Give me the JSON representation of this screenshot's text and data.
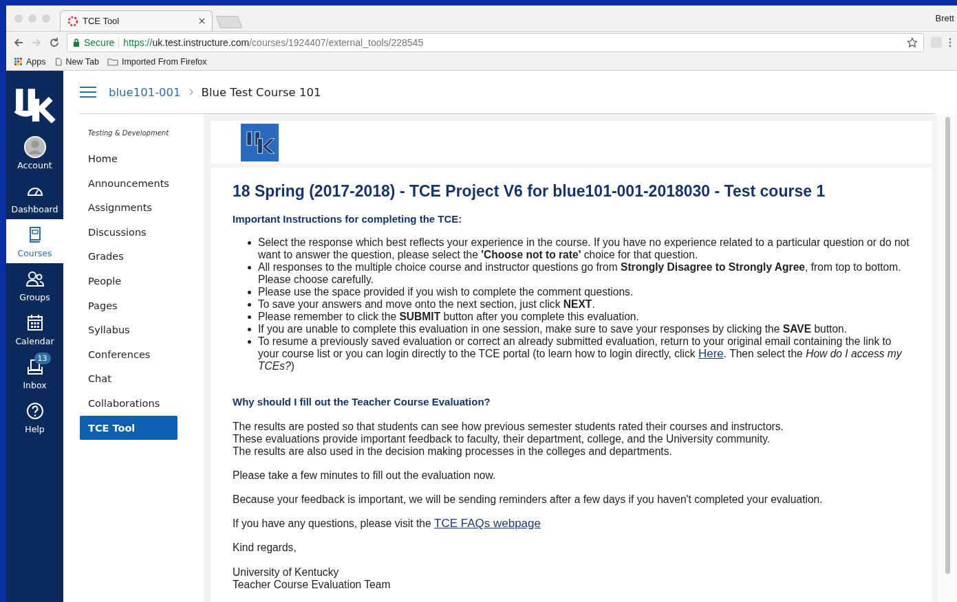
{
  "browser": {
    "tab_title": "TCE Tool",
    "profile": "Brett",
    "secure_label": "Secure",
    "url_scheme": "https://",
    "url_host": "uk.test.instructure.com",
    "url_path": "/courses/1924407/external_tools/228545",
    "bookmarks": [
      {
        "kind": "apps",
        "label": "Apps"
      },
      {
        "kind": "page",
        "label": "New Tab"
      },
      {
        "kind": "folder",
        "label": "Imported From Firefox"
      }
    ]
  },
  "global_nav": [
    {
      "kind": "account",
      "label": "Account",
      "selected": false
    },
    {
      "kind": "dashboard",
      "label": "Dashboard",
      "selected": false
    },
    {
      "kind": "courses",
      "label": "Courses",
      "selected": true
    },
    {
      "kind": "groups",
      "label": "Groups",
      "selected": false
    },
    {
      "kind": "calendar",
      "label": "Calendar",
      "selected": false
    },
    {
      "kind": "inbox",
      "label": "Inbox",
      "selected": false,
      "badge": "13"
    },
    {
      "kind": "help",
      "label": "Help",
      "selected": false
    }
  ],
  "breadcrumb": {
    "course_code": "blue101-001",
    "course_name": "Blue Test Course 101"
  },
  "course_nav": {
    "term": "Testing & Development",
    "items": [
      {
        "label": "Home",
        "selected": false
      },
      {
        "label": "Announcements",
        "selected": false
      },
      {
        "label": "Assignments",
        "selected": false
      },
      {
        "label": "Discussions",
        "selected": false
      },
      {
        "label": "Grades",
        "selected": false
      },
      {
        "label": "People",
        "selected": false
      },
      {
        "label": "Pages",
        "selected": false
      },
      {
        "label": "Syllabus",
        "selected": false
      },
      {
        "label": "Conferences",
        "selected": false
      },
      {
        "label": "Chat",
        "selected": false
      },
      {
        "label": "Collaborations",
        "selected": false
      },
      {
        "label": "TCE Tool",
        "selected": true
      }
    ]
  },
  "content": {
    "title": "18 Spring (2017-2018) - TCE Project V6 for blue101-001-2018030 - Test course 1",
    "instructions_heading": "Important Instructions for completing the TCE:",
    "instructions": [
      {
        "text": "Select the response which best reflects your experience in the course. If you have no experience related to a particular question or do not want to answer the question, please select the **'Choose not to rate'** choice for that question."
      },
      {
        "text": "All responses to the multiple choice course and instructor questions go from **Strongly Disagree to Strongly Agree**, from top to bottom. Please choose carefully."
      },
      {
        "text": "Please use the space provided if you wish to complete the comment questions."
      },
      {
        "text": "To save your answers and move onto the next section, just click **NEXT**."
      },
      {
        "text": "Please remember to click the **SUBMIT** button after you complete this evaluation."
      },
      {
        "text": "If you are unable to complete this evaluation in one session, make sure to save your responses by clicking the **SAVE** button."
      },
      {
        "text": "To resume a previously saved evaluation or correct an already submitted evaluation, return to your original email containing the link to your course list or you can login directly to the TCE portal (to learn how to login directly, click ",
        "link": "Here",
        "after": ". Then select the *How do I access my TCEs?*)"
      }
    ],
    "why_heading": "Why should I fill out the Teacher Course Evaluation?",
    "why_lines": [
      "The results are posted so that students can see how previous semester students rated their courses and instructors.",
      "These evaluations provide important feedback to faculty, their department, college, and the University community.",
      "The results are also used in the decision making processes in the colleges and departments."
    ],
    "paragraphs": [
      {
        "text": "Please take a few minutes to fill out the evaluation now."
      },
      {
        "text": "Because your feedback is important, we will be sending reminders after a few days if you haven't completed your evaluation."
      },
      {
        "text": "If you have any questions, please visit the ",
        "link": "TCE FAQs webpage"
      },
      {
        "text": "Kind regards,"
      }
    ],
    "signature": [
      "University of Kentucky",
      "Teacher Course Evaluation Team"
    ]
  }
}
